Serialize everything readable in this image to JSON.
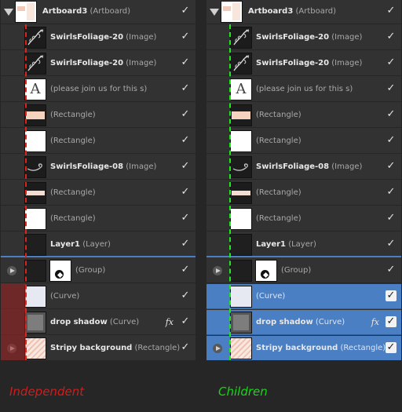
{
  "layers": [
    {
      "name": "Artboard3",
      "type": "(Artboard)",
      "thumb": "artboard",
      "control": "collapse"
    },
    {
      "name": "SwirlsFoliage-20",
      "type": "(Image)",
      "thumb": "swirl"
    },
    {
      "name": "SwirlsFoliage-20",
      "type": "(Image)",
      "thumb": "swirl"
    },
    {
      "name": "",
      "type": "(please join us for this s)",
      "thumb": "text"
    },
    {
      "name": "",
      "type": "(Rectangle)",
      "thumb": "peach"
    },
    {
      "name": "",
      "type": "(Rectangle)",
      "thumb": "white"
    },
    {
      "name": "SwirlsFoliage-08",
      "type": "(Image)",
      "thumb": "swirl2"
    },
    {
      "name": "",
      "type": "(Rectangle)",
      "thumb": "palestrip"
    },
    {
      "name": "",
      "type": "(Rectangle)",
      "thumb": "white"
    },
    {
      "name": "Layer1",
      "type": "(Layer)",
      "thumb": "dark"
    },
    {
      "name": "",
      "type": "(Group)",
      "thumb": "dark",
      "thumb2": "group",
      "control": "expand"
    },
    {
      "name": "",
      "type": "(Curve)",
      "thumb": "curve"
    },
    {
      "name": "drop shadow",
      "type": "(Curve)",
      "thumb": "shadow",
      "fx": "fx"
    },
    {
      "name": "Stripy background",
      "type": "(Rectangle)",
      "thumb": "stripy",
      "control": "expand"
    }
  ],
  "thumb_text": "A",
  "check_glyph": "✓",
  "captions": {
    "left": "Independent",
    "right": "Children"
  },
  "colors": {
    "panel_bg": "#323232",
    "selection": "#4a7fc4",
    "independent_line": "#e0241b",
    "children_line": "#1ee81e"
  },
  "panels": {
    "left": {
      "selected_rows": [],
      "overlay": "independent"
    },
    "right": {
      "selected_rows": [
        11,
        12,
        13
      ],
      "overlay": "children"
    }
  }
}
